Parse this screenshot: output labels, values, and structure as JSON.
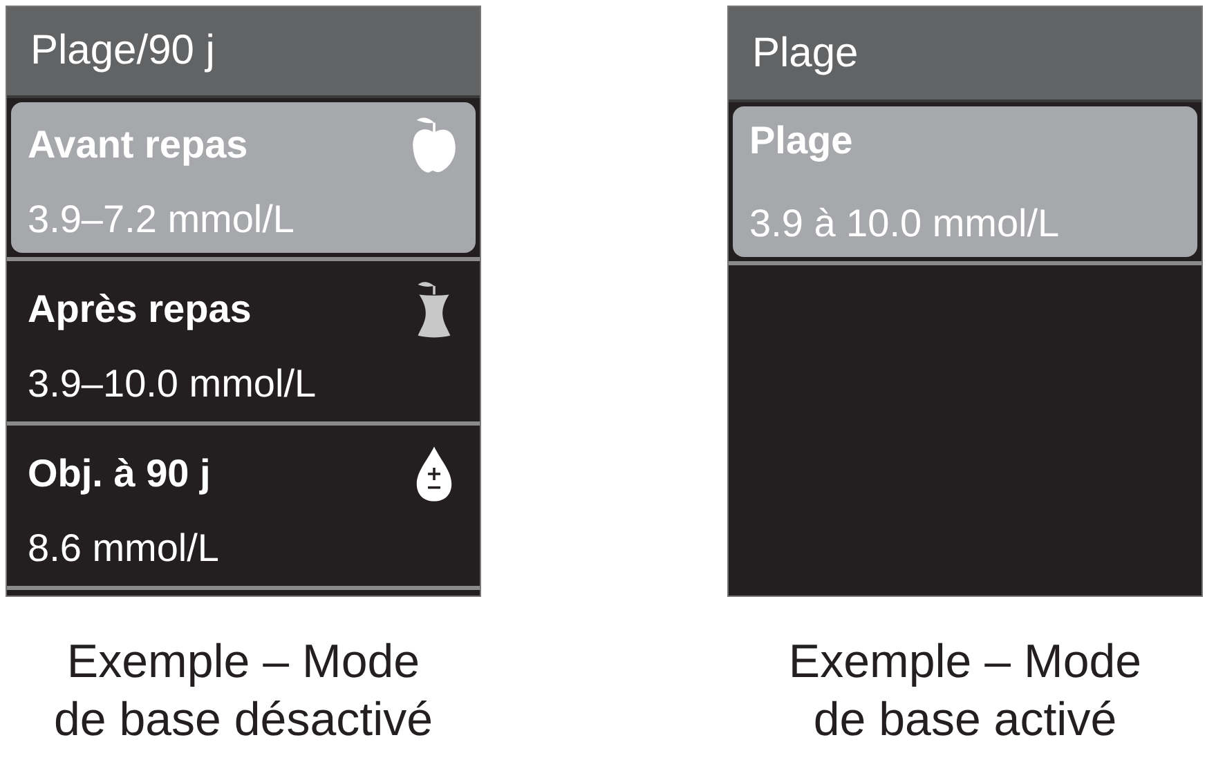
{
  "screens": [
    {
      "title": "Plage/90 j",
      "items": [
        {
          "label": "Avant repas",
          "value": "3.9–7.2 mmol/L",
          "selected": true,
          "kind": "apple"
        },
        {
          "label": "Après repas",
          "value": "3.9–10.0 mmol/L",
          "selected": false,
          "kind": "apple-core"
        },
        {
          "label": "Obj. à 90 j",
          "value": "8.6 mmol/L",
          "selected": false,
          "kind": "drop"
        }
      ],
      "caption_lines": [
        "Exemple – Mode",
        "de base désactivé"
      ]
    },
    {
      "title": "Plage",
      "items": [
        {
          "label": "Plage",
          "value": "3.9 à 10.0 mmol/L",
          "selected": true
        }
      ],
      "caption_lines": [
        "Exemple – Mode",
        "de base activé"
      ]
    }
  ]
}
